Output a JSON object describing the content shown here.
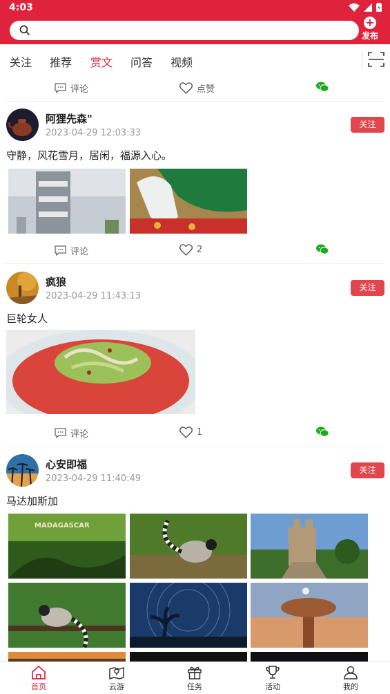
{
  "status": {
    "time": "4:03"
  },
  "header": {
    "publish_label": "发布",
    "search_placeholder": ""
  },
  "tabs": [
    {
      "label": "关注"
    },
    {
      "label": "推荐"
    },
    {
      "label": "赏文",
      "active": true
    },
    {
      "label": "问答"
    },
    {
      "label": "视频"
    }
  ],
  "actions": {
    "comment_label": "评论",
    "like_label": "点赞"
  },
  "posts": [
    {
      "name": "阿狸先森\"",
      "date": "2023-04-29 12:03:33",
      "follow": "关注",
      "text": "守静，风花雪月，居闲，福源入心。",
      "likes": "2"
    },
    {
      "name": "疯狼",
      "date": "2023-04-29 11:43:13",
      "follow": "关注",
      "text": "巨轮女人",
      "likes": "1"
    },
    {
      "name": "心安即福",
      "date": "2023-04-29 11:40:49",
      "follow": "关注",
      "text": "马达加斯加",
      "img_caption": "MADAGASCAR"
    }
  ],
  "nav": [
    {
      "label": "首页",
      "icon": "home-icon"
    },
    {
      "label": "云游",
      "icon": "map-icon"
    },
    {
      "label": "任务",
      "icon": "gift-icon"
    },
    {
      "label": "活动",
      "icon": "trophy-icon"
    },
    {
      "label": "我的",
      "icon": "user-icon"
    }
  ],
  "colors": {
    "brand": "#e0233c",
    "follow": "#e0474c",
    "wechat": "#1aad19"
  }
}
